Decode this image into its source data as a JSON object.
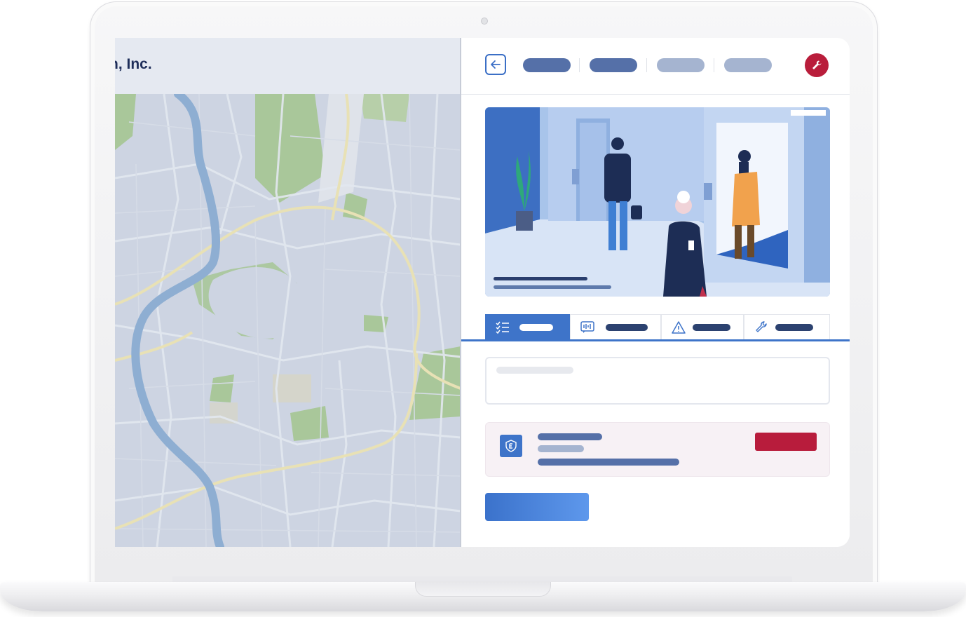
{
  "company_name": "n, Inc.",
  "colors": {
    "brand_navy": "#1f2e5a",
    "accent_blue": "#3e74c9",
    "danger_red": "#b91d3b",
    "map_land": "#cdd4e2",
    "map_park": "#a9c79a",
    "map_river": "#8eaed2"
  },
  "toolbar": {
    "back_icon": "arrow-left-icon",
    "settings_icon": "wrench-icon"
  },
  "tabs": [
    {
      "icon": "checklist-icon",
      "active": true
    },
    {
      "icon": "audio-message-icon",
      "active": false
    },
    {
      "icon": "warning-icon",
      "active": false
    },
    {
      "icon": "wrench-icon",
      "active": false
    }
  ],
  "alert_card": {
    "icon": "shield-icon"
  }
}
